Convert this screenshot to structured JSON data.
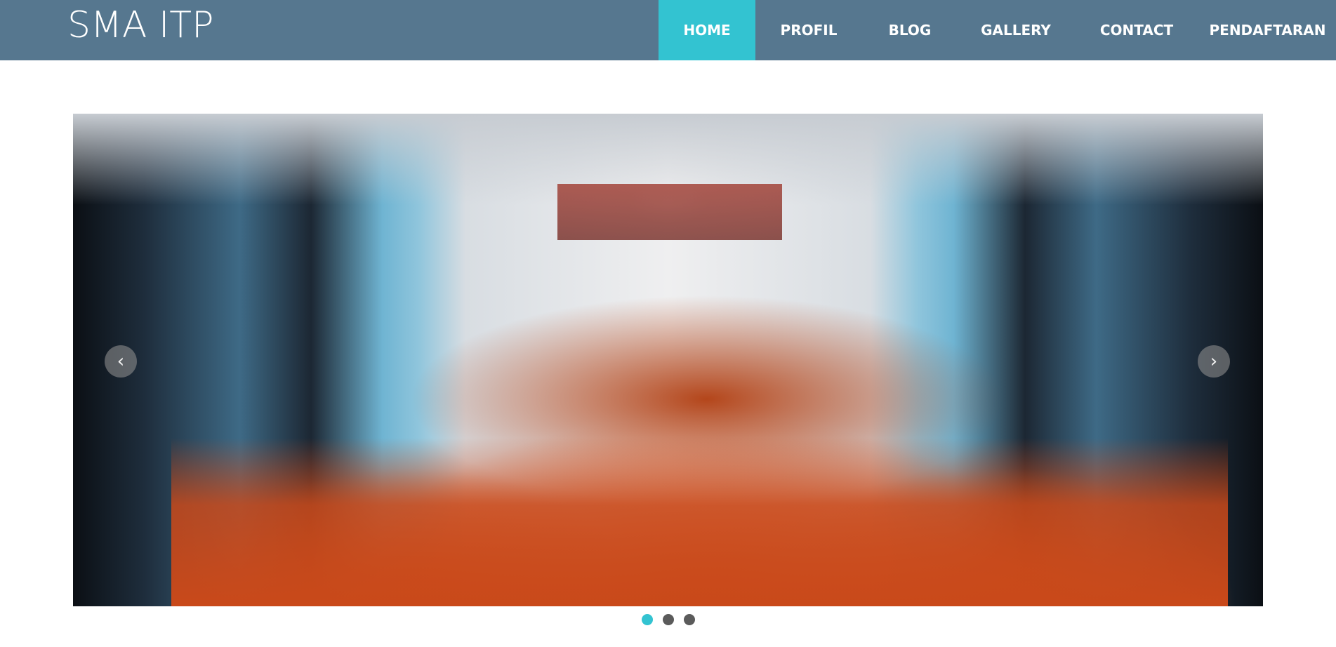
{
  "site": {
    "brand": "SMA ITP"
  },
  "nav": {
    "items": [
      {
        "label": "HOME",
        "active": true
      },
      {
        "label": "PROFIL",
        "active": false
      },
      {
        "label": "BLOG",
        "active": false
      },
      {
        "label": "GALLERY",
        "active": false
      },
      {
        "label": "CONTACT",
        "active": false
      },
      {
        "label": "PENDAFTARAN",
        "active": false
      }
    ]
  },
  "carousel": {
    "slide_count": 3,
    "active_index": 0,
    "prev_icon": "chevron-left-icon",
    "next_icon": "chevron-right-icon"
  },
  "colors": {
    "navbar": "#56778f",
    "accent": "#33c3d1",
    "dot_inactive": "#5b5b5b"
  }
}
